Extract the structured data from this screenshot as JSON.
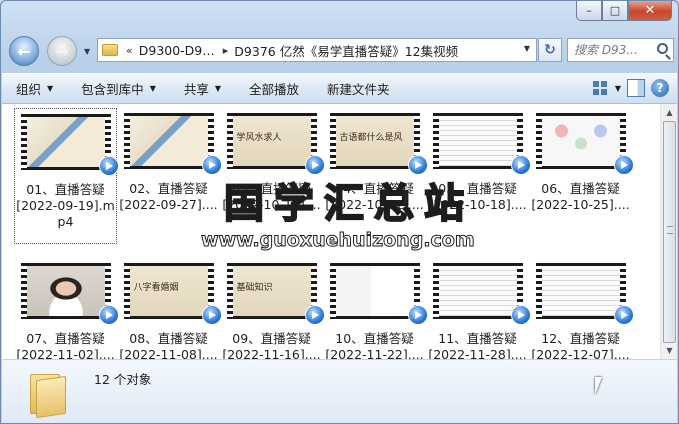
{
  "window": {
    "caption_buttons": [
      "–",
      "□",
      "✕"
    ]
  },
  "address": {
    "chevrons": "«",
    "crumbs": [
      "D9300-D9…",
      "D9376 亿然《易学直播答疑》12集视频"
    ],
    "separator": "▸"
  },
  "search": {
    "placeholder": "搜索 D93..."
  },
  "toolbar": {
    "items": [
      "组织",
      "包含到库中",
      "共享",
      "全部播放",
      "新建文件夹"
    ]
  },
  "files": [
    {
      "line1": "01、直播答疑",
      "line2": "[2022-09-19].m",
      "line3": "p4",
      "thumb_text": "",
      "selected": true,
      "theme": "board"
    },
    {
      "line1": "02、直播答疑",
      "line2": "[2022-09-27]....",
      "thumb_text": "",
      "theme": "board"
    },
    {
      "line1": "03、直播答疑",
      "line2": "[2022-10-11]....",
      "thumb_text": "学风水求人",
      "theme": "paper"
    },
    {
      "line1": "04、直播答疑",
      "line2": "[2022-10-11]....",
      "thumb_text": "古语都什么是风",
      "theme": "paper"
    },
    {
      "line1": "05、直播答疑",
      "line2": "[2022-10-18]....",
      "thumb_text": "",
      "theme": "slide"
    },
    {
      "line1": "06、直播答疑",
      "line2": "[2022-10-25]....",
      "thumb_text": "",
      "theme": "diagram"
    },
    {
      "line1": "07、直播答疑",
      "line2": "[2022-11-02]....",
      "thumb_text": "",
      "theme": "person"
    },
    {
      "line1": "08、直播答疑",
      "line2": "[2022-11-08]....",
      "thumb_text": "八字看婚姻",
      "theme": "paper"
    },
    {
      "line1": "09、直播答疑",
      "line2": "[2022-11-16]....",
      "thumb_text": "基础知识",
      "theme": "paper"
    },
    {
      "line1": "10、直播答疑",
      "line2": "[2022-11-22]....",
      "thumb_text": "",
      "theme": "phone"
    },
    {
      "line1": "11、直播答疑",
      "line2": "[2022-11-28]....",
      "thumb_text": "",
      "theme": "slide"
    },
    {
      "line1": "12、直播答疑",
      "line2": "[2022-12-07]....",
      "thumb_text": "",
      "theme": "slide"
    }
  ],
  "watermark": {
    "title": "国学汇总站",
    "url": "www.guoxuehuizong.com"
  },
  "status": {
    "count_text": "12 个对象"
  },
  "colors": {
    "chrome": "#b9d0ea",
    "toolbar": "#dde8f5",
    "selection_border": "#555555"
  }
}
